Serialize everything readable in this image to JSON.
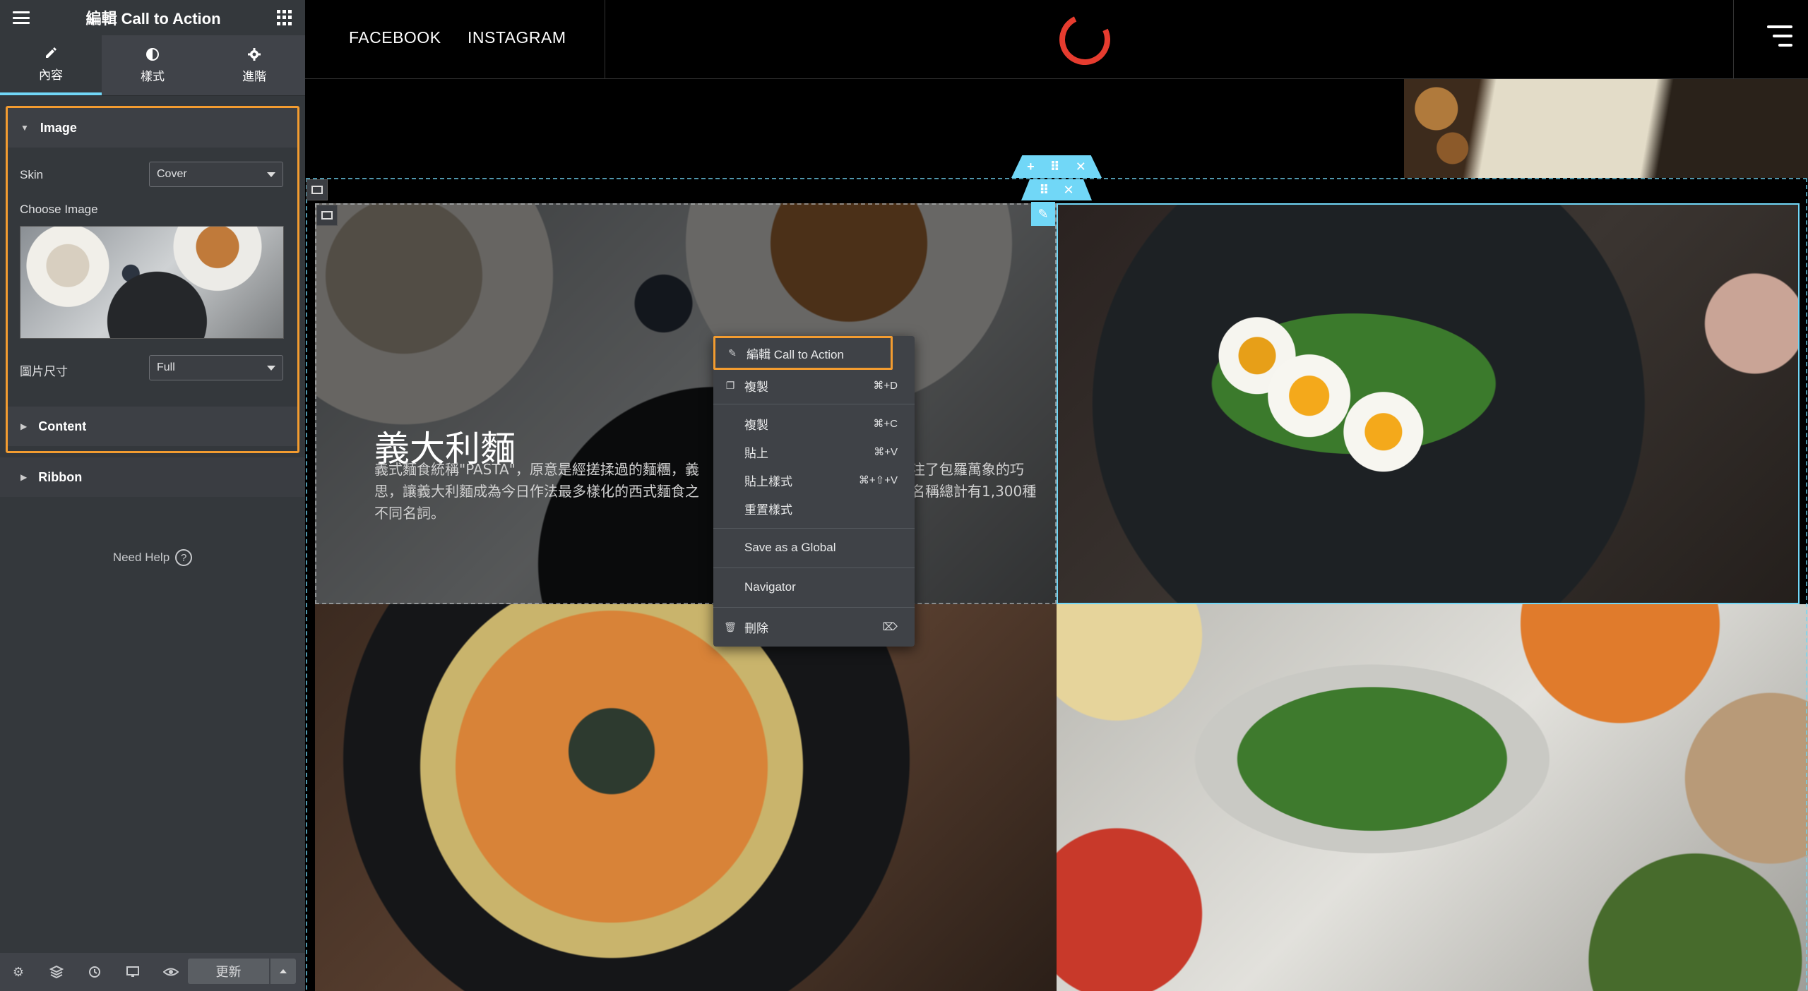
{
  "panel": {
    "header": {
      "title": "編輯 Call to Action"
    },
    "tabs": [
      {
        "label": "內容",
        "icon": "pencil-icon",
        "active": true
      },
      {
        "label": "樣式",
        "icon": "contrast-icon",
        "active": false
      },
      {
        "label": "進階",
        "icon": "gear-icon",
        "active": false
      }
    ],
    "sections": {
      "image": {
        "title": "Image",
        "skin_label": "Skin",
        "skin_value": "Cover",
        "choose_image_label": "Choose Image",
        "size_label": "圖片尺寸",
        "size_value": "Full"
      },
      "content": {
        "title": "Content"
      },
      "ribbon": {
        "title": "Ribbon"
      }
    },
    "need_help": "Need Help",
    "footer": {
      "update_label": "更新"
    }
  },
  "site": {
    "nav": {
      "facebook": "FACEBOOK",
      "instagram": "INSTAGRAM"
    },
    "cta": {
      "title": "義大利麵",
      "description": "義式麵食統稱\"PASTA\"，原意是經搓揉過的麵糰，義　　　　　　　　　　　　　　　注了包羅萬象的巧思，讓義大利麵成為今日作法最多樣化的西式麵食之　　　　　　　　　　　　　　　名稱總計有1,300種不同名詞。"
    }
  },
  "context_menu": {
    "items": [
      {
        "label": "編輯 Call to Action",
        "shortcut": "",
        "icon": "pencil-icon"
      },
      {
        "label": "複製",
        "shortcut": "⌘+D",
        "icon": "duplicate-icon"
      },
      {
        "label": "複製",
        "shortcut": "⌘+C",
        "icon": ""
      },
      {
        "label": "貼上",
        "shortcut": "⌘+V",
        "icon": ""
      },
      {
        "label": "貼上樣式",
        "shortcut": "⌘+⇧+V",
        "icon": ""
      },
      {
        "label": "重置樣式",
        "shortcut": "",
        "icon": ""
      },
      {
        "label": "Save as a Global",
        "shortcut": "",
        "icon": ""
      },
      {
        "label": "Navigator",
        "shortcut": "",
        "icon": ""
      },
      {
        "label": "刪除",
        "shortcut": "⌦",
        "icon": "trash-icon"
      }
    ]
  },
  "colors": {
    "accent": "#71d7f7",
    "highlight": "#f39c30",
    "logo": "#e63c2f",
    "panel_bg": "#34383c"
  }
}
